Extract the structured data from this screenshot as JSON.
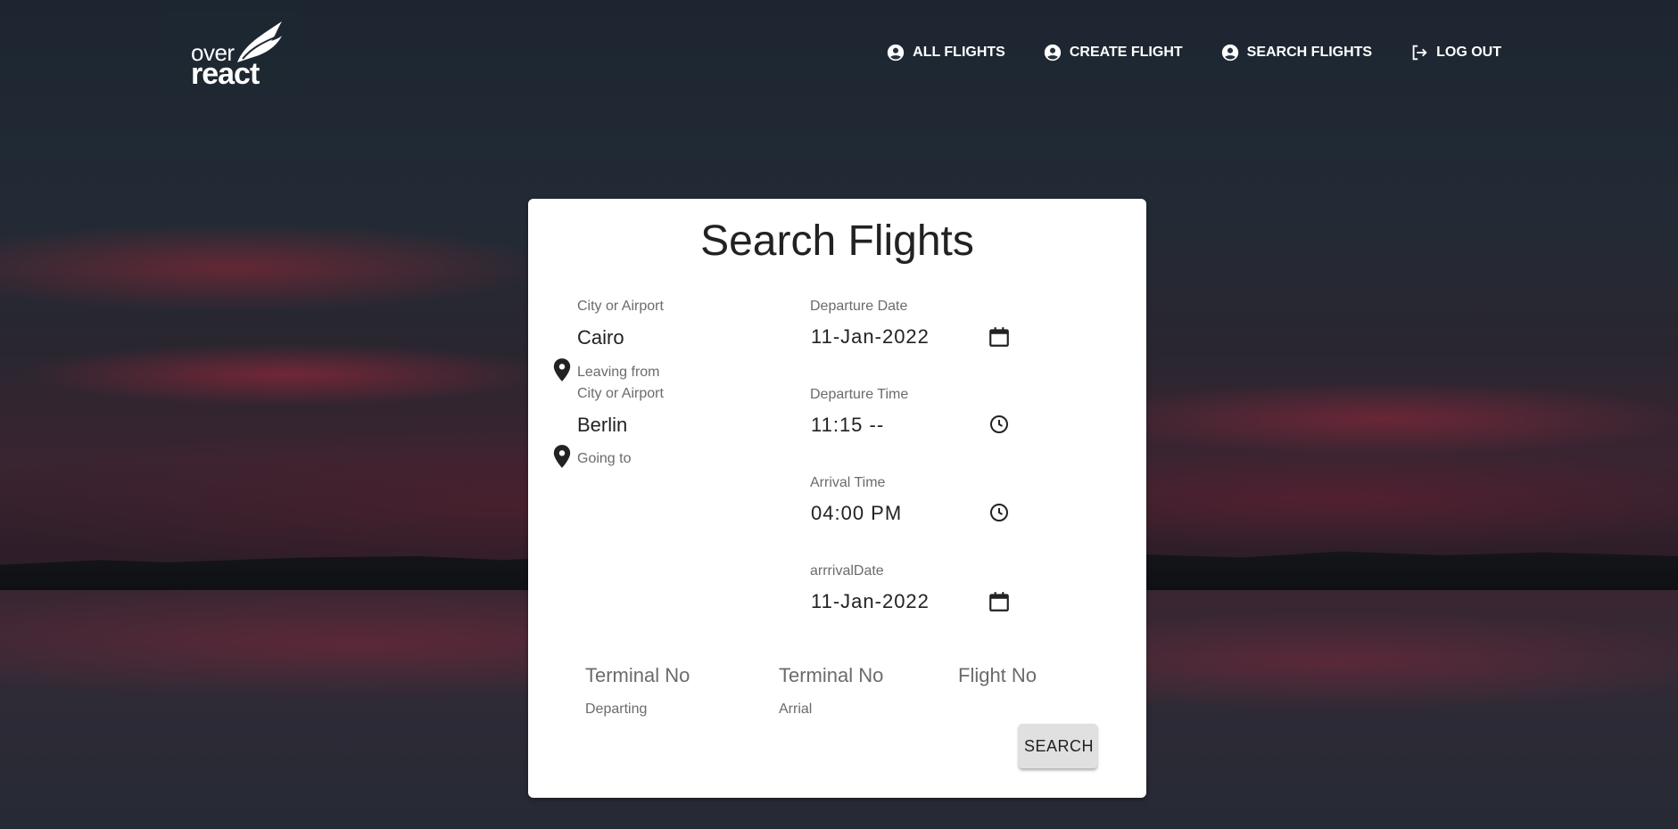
{
  "header": {
    "logo_top": "over",
    "logo_bottom": "react",
    "nav": [
      {
        "label": "ALL FLIGHTS",
        "icon": "user-circle-icon"
      },
      {
        "label": "CREATE FLIGHT",
        "icon": "user-circle-icon"
      },
      {
        "label": "SEARCH FLIGHTS",
        "icon": "user-circle-icon"
      },
      {
        "label": "LOG OUT",
        "icon": "logout-icon"
      }
    ]
  },
  "form": {
    "title": "Search Flights",
    "from": {
      "label": "City or Airport",
      "value": "Cairo",
      "helper": "Leaving from"
    },
    "to": {
      "label": "City or Airport",
      "value": "Berlin",
      "helper": "Going to"
    },
    "departure_date": {
      "label": "Departure Date",
      "value": "11-Jan-2022"
    },
    "departure_time": {
      "label": "Departure Time",
      "value": "11:15 --"
    },
    "arrival_time": {
      "label": "Arrival Time",
      "value": "04:00 PM"
    },
    "arrival_date": {
      "label": "arrrivalDate",
      "value": "11-Jan-2022"
    },
    "terminal_departing": {
      "placeholder": "Terminal No",
      "helper": "Departing"
    },
    "terminal_arrival": {
      "placeholder": "Terminal No",
      "helper": "Arrial"
    },
    "flight_no": {
      "placeholder": "Flight No"
    },
    "search_label": "SEARCH"
  }
}
